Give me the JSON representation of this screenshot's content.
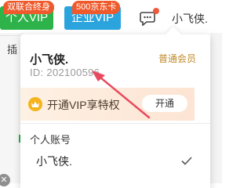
{
  "topbar": {
    "personal_vip_label": "个人VIP",
    "enterprise_vip_label": "企业VIP",
    "promo_badges": [
      "双联合终身",
      "500京东卡"
    ],
    "username": "小飞侠."
  },
  "background": {
    "side_text": "插"
  },
  "dropdown": {
    "user_name": "小飞侠.",
    "member_level": "普通会员",
    "user_id": "ID: 202100596",
    "vip_promo_text": "开通VIP享特权",
    "open_button_label": "开通",
    "section_label": "个人账号",
    "account_name": "小飞侠."
  },
  "colors": {
    "personal_vip_bg": "#2db34a",
    "enterprise_vip_bg": "#2ba4de",
    "promo_badge": "#ef5a2c",
    "member_level": "#c08a2a",
    "annotation_arrow": "#e84a5f"
  },
  "icons": {
    "chat": "chat-bubble-icon",
    "crown": "crown-icon",
    "check": "checkmark-icon"
  }
}
